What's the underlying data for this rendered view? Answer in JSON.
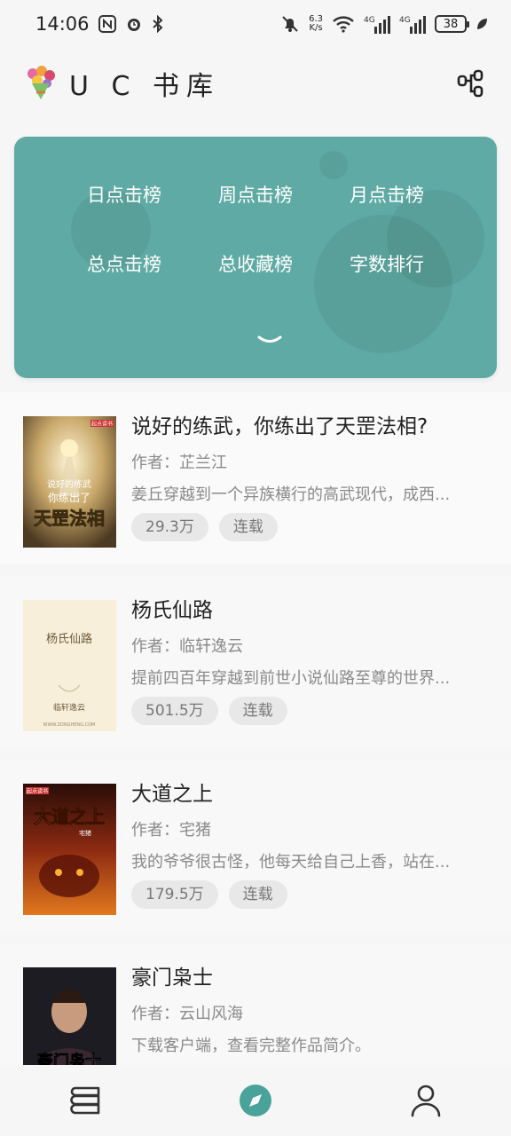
{
  "status_bar": {
    "time": "14:06",
    "net_speed_value": "6.3",
    "net_speed_unit": "K/s",
    "signal_1": "4G",
    "signal_2": "4G",
    "battery": "38"
  },
  "header": {
    "title": "U C 书库"
  },
  "ranking": {
    "items": [
      {
        "label": "日点击榜"
      },
      {
        "label": "周点击榜"
      },
      {
        "label": "月点击榜"
      },
      {
        "label": "总点击榜"
      },
      {
        "label": "总收藏榜"
      },
      {
        "label": "字数排行"
      }
    ],
    "accent": "#5faaa4"
  },
  "books": [
    {
      "title": "说好的练武，你练出了天罡法相?",
      "author": "作者：芷兰江",
      "description": "姜丘穿越到一个异族横行的高武现代，成西...",
      "count": "29.3万",
      "status": "连载",
      "cover_text_1": "说好的练武",
      "cover_text_2": "你练出了",
      "cover_text_3": "天罡法相",
      "cover_tag": "起点读书"
    },
    {
      "title": "杨氏仙路",
      "author": "作者：临轩逸云",
      "description": "提前四百年穿越到前世小说仙路至尊的世界...",
      "count": "501.5万",
      "status": "连载",
      "cover_text_1": "杨氏仙路",
      "cover_text_2": "临轩逸云",
      "cover_text_3": "WWW.ZONGHENG.COM"
    },
    {
      "title": "大道之上",
      "author": "作者：宅猪",
      "description": "我的爷爷很古怪，他每天给自己上香，站在...",
      "count": "179.5万",
      "status": "连载",
      "cover_text_1": "大道之上",
      "cover_text_2": "宅猪",
      "cover_tag": "起点读书"
    },
    {
      "title": "豪门枭士",
      "author": "作者：云山风海",
      "description": "下载客户端，查看完整作品简介。",
      "count": "",
      "status": "",
      "cover_text_1": "豪门枭士"
    }
  ],
  "bottom_nav": {
    "active_color": "#4aa39b"
  }
}
